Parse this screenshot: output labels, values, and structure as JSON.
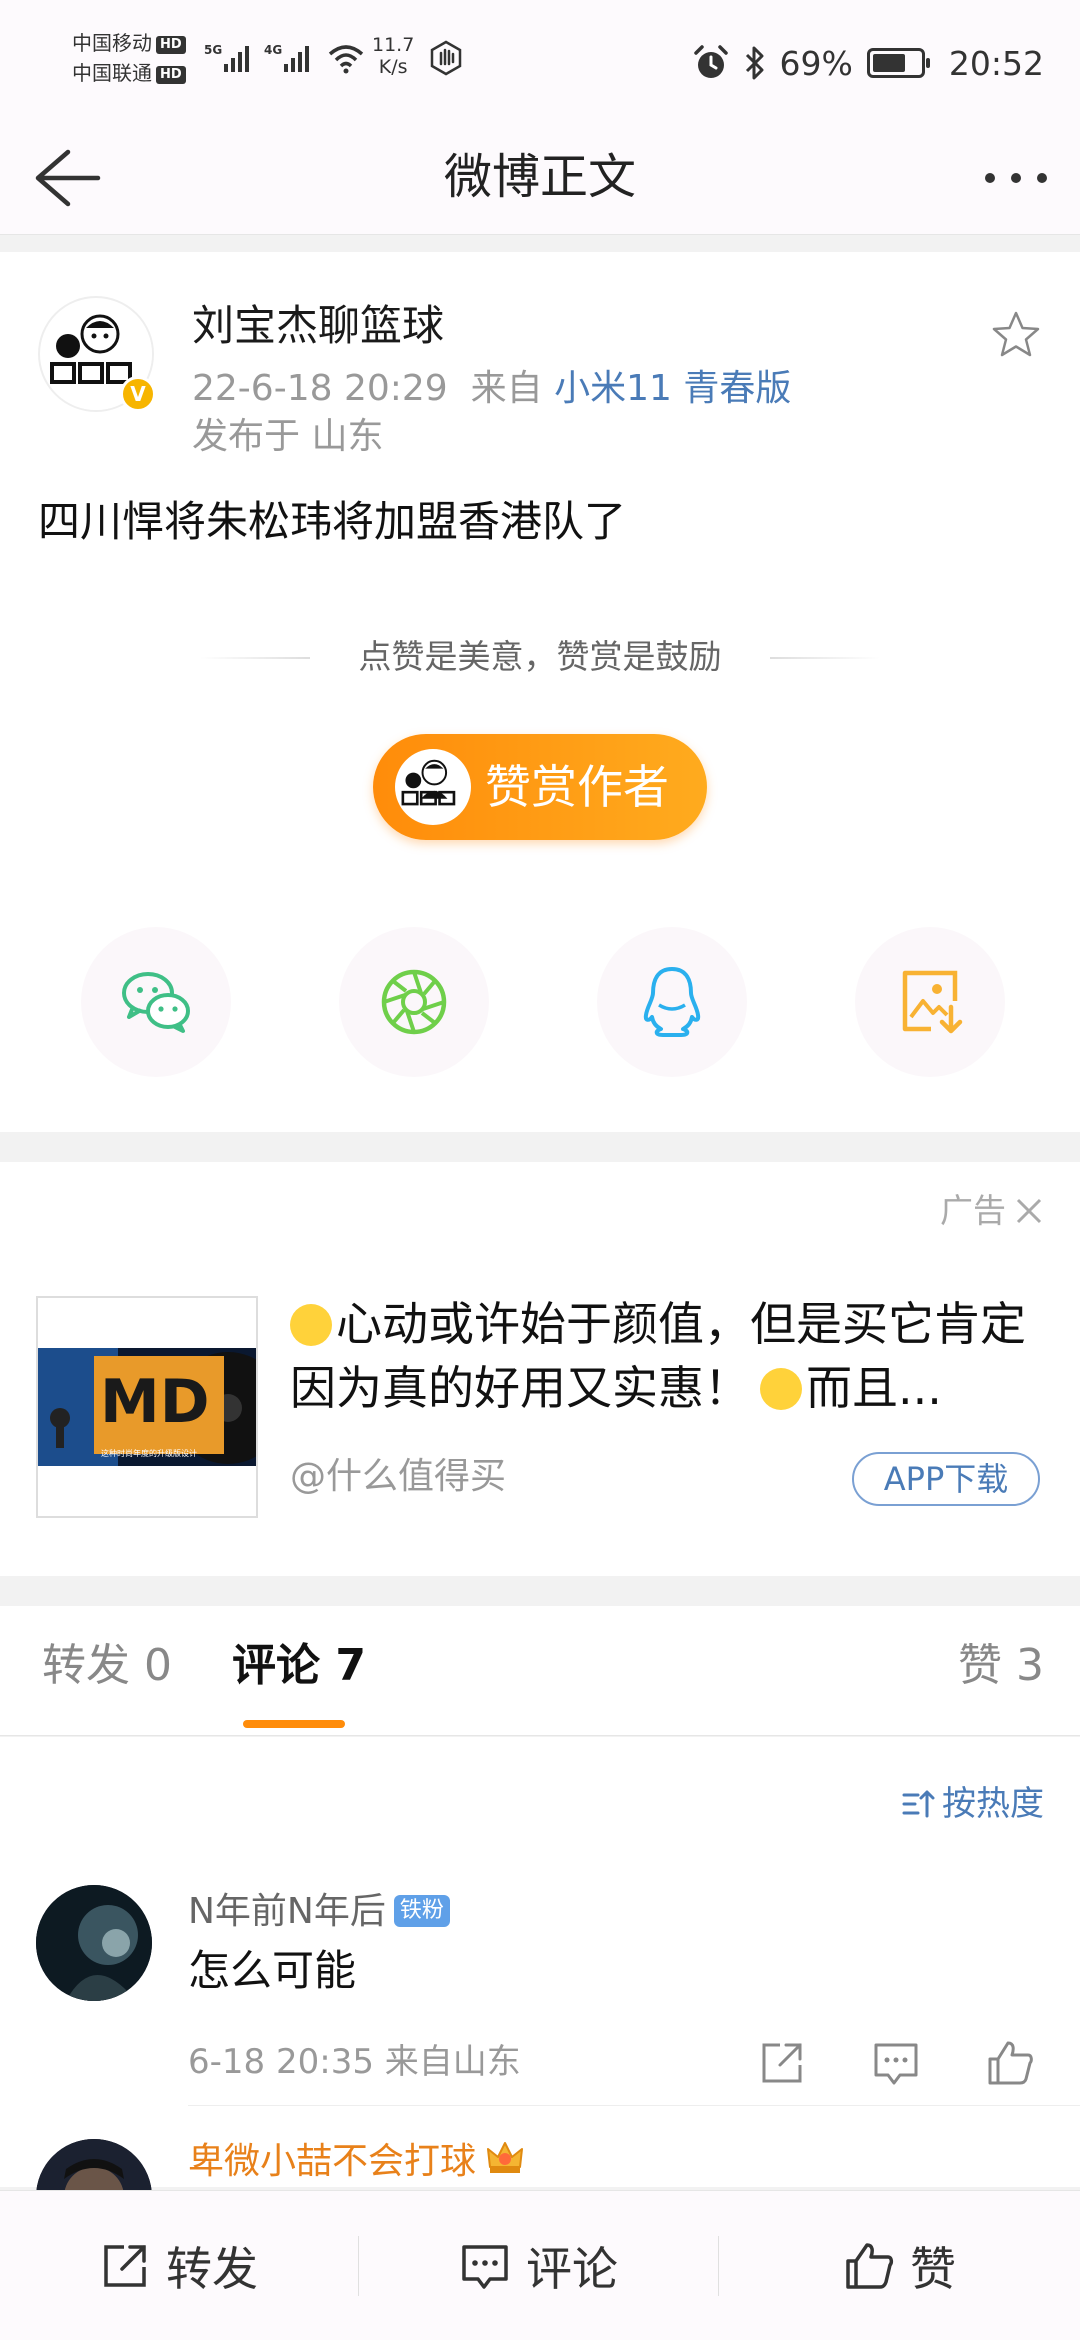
{
  "status_bar": {
    "carrier1": "中国移动",
    "carrier2": "中国联通",
    "hd": "HD",
    "net1": "5G",
    "net2": "4G",
    "speed_value": "11.7",
    "speed_unit": "K/s",
    "battery": "69%",
    "battery_level": 0.69,
    "time": "20:52"
  },
  "nav": {
    "title": "微博正文"
  },
  "post": {
    "author": "刘宝杰聊篮球",
    "time": "22-6-18 20:29",
    "source_prefix": "来自",
    "device": "小米11 青春版",
    "region": "发布于 山东",
    "text": "四川悍将朱松玮将加盟香港队了",
    "reward_tip": "点赞是美意，赞赏是鼓励",
    "reward_button": "赞赏作者"
  },
  "share": {
    "icons": [
      "wechat-icon",
      "moments-icon",
      "qq-icon",
      "save-image-icon"
    ]
  },
  "ad": {
    "label": "广告",
    "text_part1": "心动或许始于颜值，但是买它肯定因为真的好用又实惠！",
    "text_part2": "而且...",
    "source": "@什么值得买",
    "download": "APP下载",
    "thumb_logo": "MD",
    "thumb_caption": "这种时尚年度的升级版设计"
  },
  "tabs": {
    "repost": "转发 0",
    "comment": "评论 7",
    "like": "赞 3"
  },
  "sort": {
    "label": "按热度"
  },
  "comments": [
    {
      "name": "N年前N年后",
      "badge": "铁粉",
      "text": "怎么可能",
      "meta": "6-18 20:35 来自山东"
    },
    {
      "name": "卑微小喆不会打球"
    }
  ],
  "bottom_bar": {
    "repost": "转发",
    "comment": "评论",
    "like": "赞"
  },
  "colors": {
    "accent_orange": "#ff8c0a",
    "link_blue": "#4a7bb7",
    "wechat_green": "#3fbf86",
    "moments_green": "#6fcf4a",
    "qq_blue": "#2ab0ee",
    "save_orange": "#f8b233"
  }
}
